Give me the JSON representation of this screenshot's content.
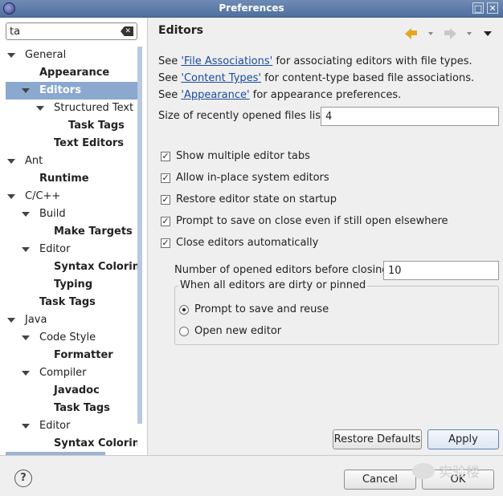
{
  "window": {
    "title": "Preferences"
  },
  "filter": {
    "value": "ta"
  },
  "tree": [
    {
      "label": "General",
      "level": 0,
      "expanded": true,
      "bold": false
    },
    {
      "label": "Appearance",
      "level": 1,
      "bold": true
    },
    {
      "label": "Editors",
      "level": 1,
      "expanded": true,
      "bold": true,
      "selected": true
    },
    {
      "label": "Structured Text Editors",
      "level": 2,
      "expanded": true,
      "bold": false
    },
    {
      "label": "Task Tags",
      "level": 3,
      "bold": true
    },
    {
      "label": "Text Editors",
      "level": 2,
      "bold": true
    },
    {
      "label": "Ant",
      "level": 0,
      "expanded": true,
      "bold": false
    },
    {
      "label": "Runtime",
      "level": 1,
      "bold": true
    },
    {
      "label": "C/C++",
      "level": 0,
      "expanded": true,
      "bold": false
    },
    {
      "label": "Build",
      "level": 1,
      "expanded": true,
      "bold": false
    },
    {
      "label": "Make Targets",
      "level": 2,
      "bold": true
    },
    {
      "label": "Editor",
      "level": 1,
      "expanded": true,
      "bold": false
    },
    {
      "label": "Syntax Coloring",
      "level": 2,
      "bold": true
    },
    {
      "label": "Typing",
      "level": 2,
      "bold": true
    },
    {
      "label": "Task Tags",
      "level": 1,
      "bold": true
    },
    {
      "label": "Java",
      "level": 0,
      "expanded": true,
      "bold": false
    },
    {
      "label": "Code Style",
      "level": 1,
      "expanded": true,
      "bold": false
    },
    {
      "label": "Formatter",
      "level": 2,
      "bold": true
    },
    {
      "label": "Compiler",
      "level": 1,
      "expanded": true,
      "bold": false
    },
    {
      "label": "Javadoc",
      "level": 2,
      "bold": true
    },
    {
      "label": "Task Tags",
      "level": 2,
      "bold": true
    },
    {
      "label": "Editor",
      "level": 1,
      "expanded": true,
      "bold": false
    },
    {
      "label": "Syntax Coloring",
      "level": 2,
      "bold": true
    }
  ],
  "page": {
    "title": "Editors",
    "links": [
      {
        "pre": "See ",
        "link": "'File Associations'",
        "post": " for associating editors with file types."
      },
      {
        "pre": "See ",
        "link": "'Content Types'",
        "post": " for content-type based file associations."
      },
      {
        "pre": "See ",
        "link": "'Appearance'",
        "post": " for appearance preferences."
      }
    ],
    "recent_label": "Size of recently opened files list:",
    "recent_value": "4",
    "checks": [
      {
        "label": "Show multiple editor tabs",
        "checked": true
      },
      {
        "label": "Allow in-place system editors",
        "checked": true
      },
      {
        "label": "Restore editor state on startup",
        "checked": true
      },
      {
        "label": "Prompt to save on close even if still open elsewhere",
        "checked": true
      },
      {
        "label": "Close editors automatically",
        "checked": true
      }
    ],
    "opened_label": "Number of opened editors before closing:",
    "opened_value": "10",
    "group_title": "When all editors are dirty or pinned",
    "radios": [
      {
        "label": "Prompt to save and reuse",
        "selected": true
      },
      {
        "label": "Open new editor",
        "selected": false
      }
    ],
    "restore_defaults": "Restore Defaults",
    "apply": "Apply"
  },
  "footer": {
    "help_glyph": "?",
    "cancel": "Cancel",
    "ok": "OK",
    "watermark": "实验楼"
  },
  "colors": {
    "selection": "#8ba9cf",
    "title_bar": "#5a79a8",
    "link": "#1a4a9e",
    "back_arrow": "#e3a722"
  }
}
